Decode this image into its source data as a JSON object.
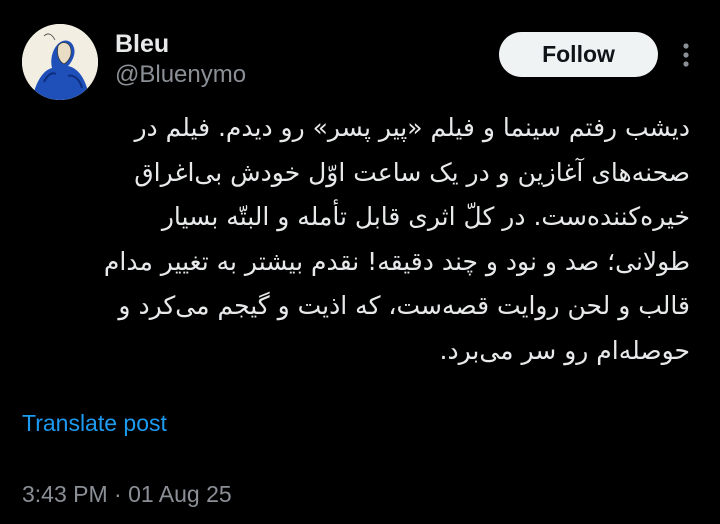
{
  "author": {
    "name": "Bleu",
    "handle": "@Bluenymo",
    "avatar_icon": "illustrated-figure-avatar"
  },
  "actions": {
    "follow_label": "Follow",
    "more_icon": "more-vertical-icon"
  },
  "post": {
    "lines": [
      "دیشب رفتم سینما و فیلم «پیر پسر» رو دیدم. فیلم در",
      "صحنه‌های آغازین و در یک ساعت اوّل خودش بی‌اغراق",
      "خیره‌کننده‌ست. در کلّ اثری قابل تأمله و البتّه بسیار",
      "طولانی؛ صد و نود و چند دقیقه! نقدم بیشتر به تغییر مدام",
      "قالب و لحن روایت قصه‌ست، که اذیت و گیجم می‌کرد و",
      "حوصله‌ام رو سر می‌برد."
    ],
    "translate_label": "Translate post",
    "timestamp": "3:43 PM · 01 Aug 25"
  },
  "colors": {
    "background": "#000000",
    "text": "#e7e9ea",
    "muted": "#8b9097",
    "link": "#1d9bf0",
    "button_bg": "#eff3f4"
  }
}
